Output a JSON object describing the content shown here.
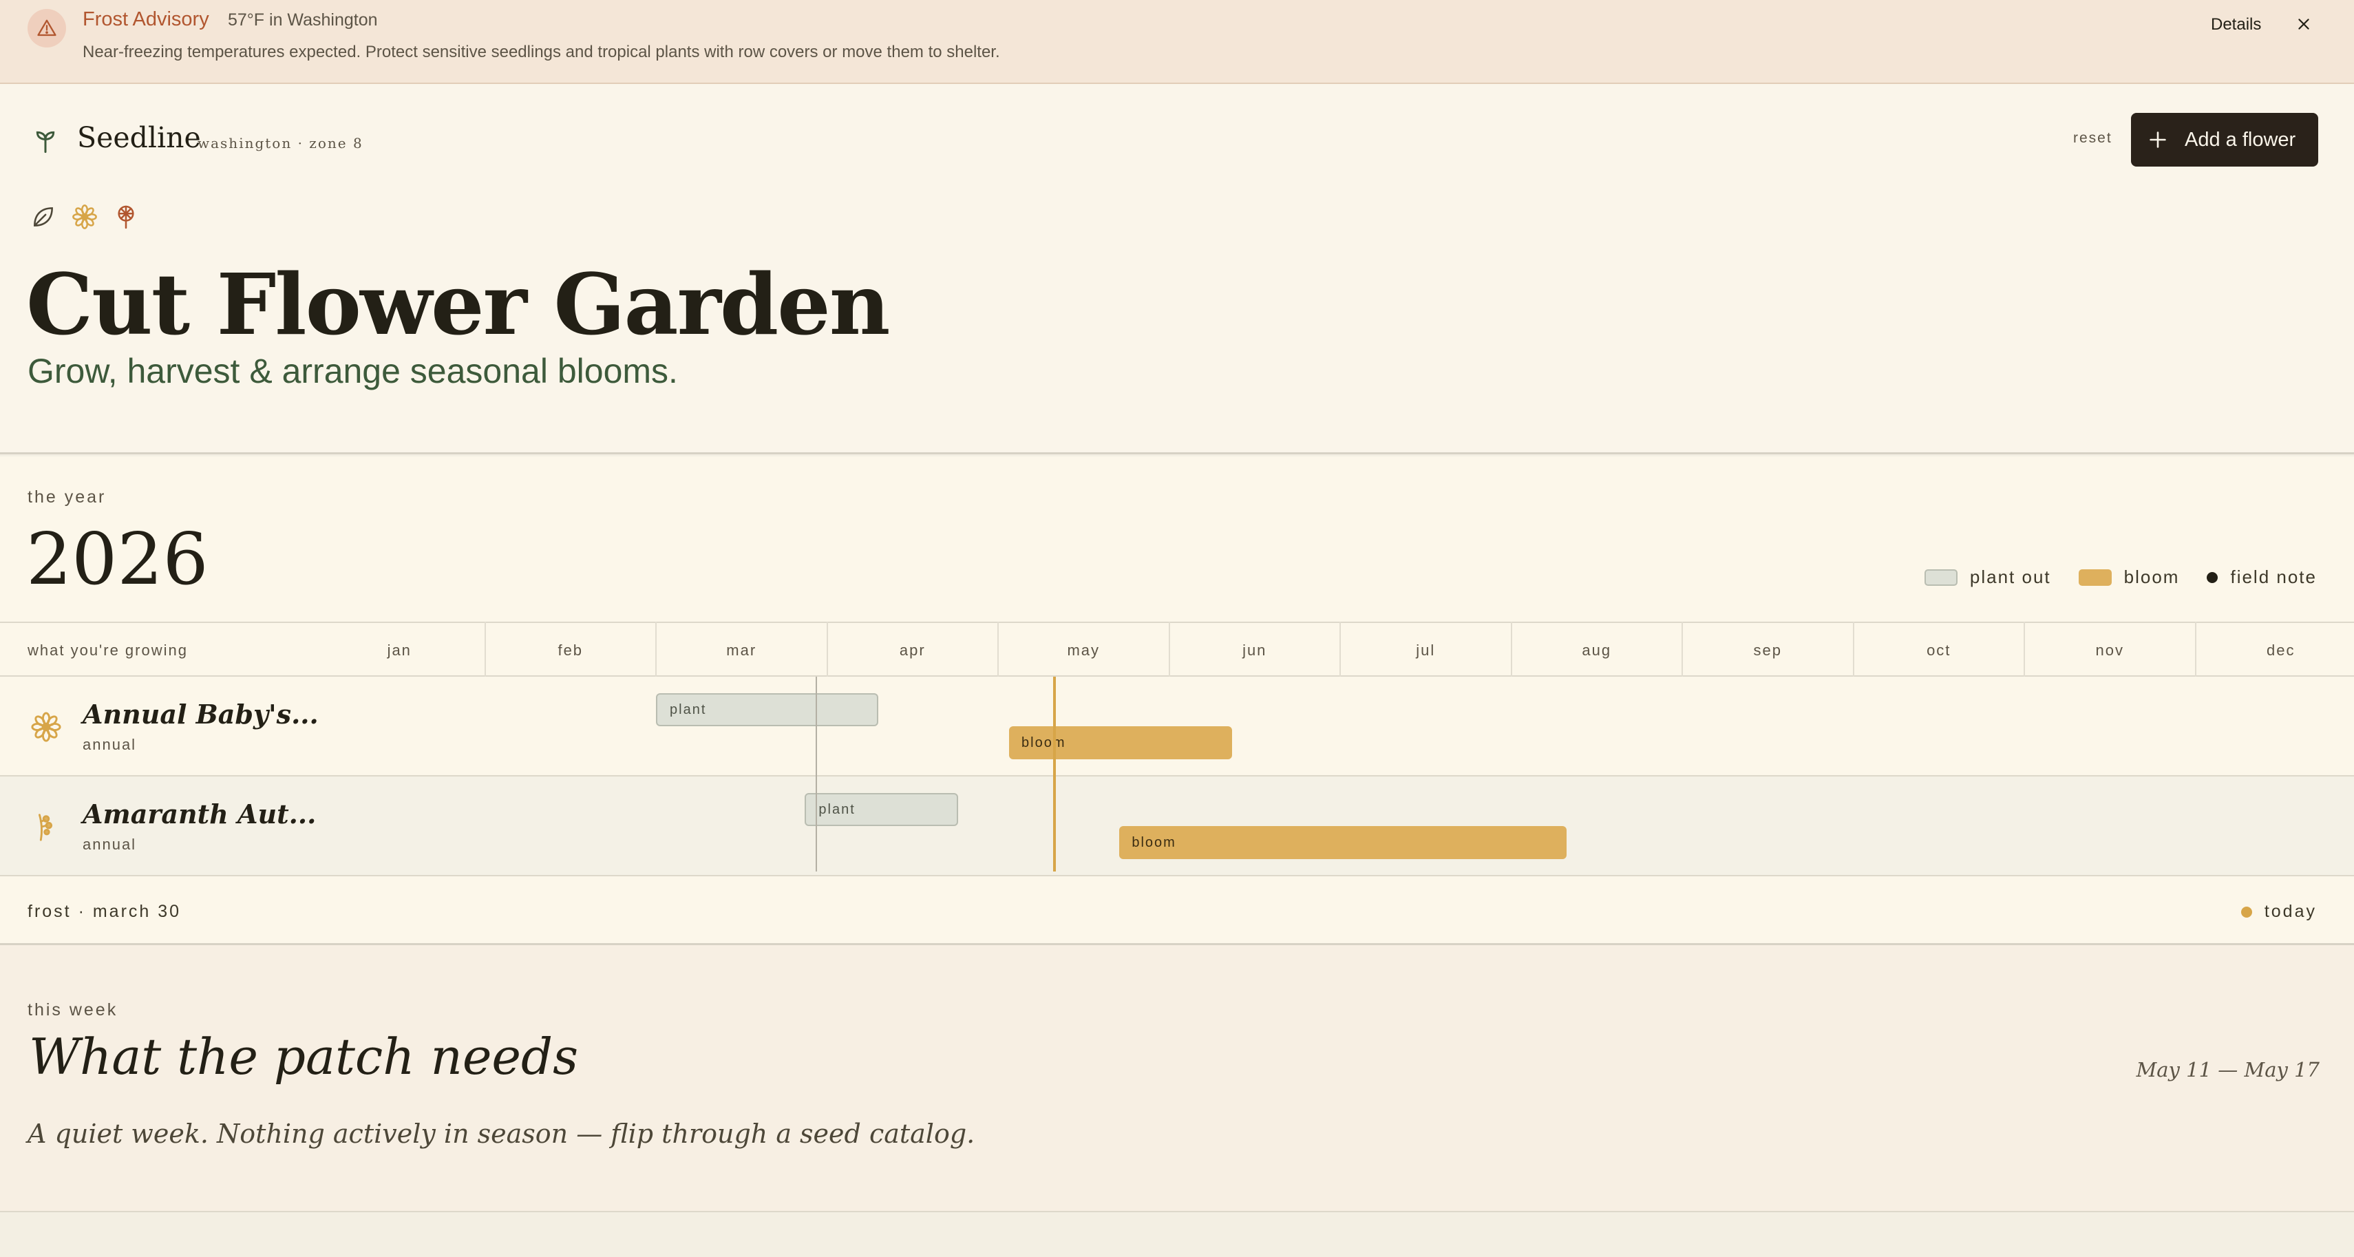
{
  "banner": {
    "title": "Frost Advisory",
    "temp": "57°F in Washington",
    "message": "Near-freezing temperatures expected. Protect sensitive seedlings and tropical plants with row covers or move them to shelter.",
    "details_label": "Details",
    "accent_color": "#b1562f"
  },
  "header": {
    "brand": "Seedline",
    "location": "washington · zone 8",
    "reset_label": "reset",
    "add_label": "Add a flower"
  },
  "hero": {
    "icons": [
      "leaf-icon",
      "daisy-icon",
      "dahlia-icon"
    ],
    "title": "Cut Flower Garden",
    "subtitle": "Grow, harvest & arrange seasonal blooms."
  },
  "year": {
    "label": "the year",
    "value": "2026",
    "legend": {
      "plant": "plant out",
      "bloom": "bloom",
      "note": "field note"
    }
  },
  "timeline": {
    "column_label": "what you're growing",
    "months": [
      "jan",
      "feb",
      "mar",
      "apr",
      "may",
      "jun",
      "jul",
      "aug",
      "sep",
      "oct",
      "nov",
      "dec"
    ],
    "rows": [
      {
        "name": "Annual Baby's...",
        "type": "annual",
        "icon": "daisy-icon",
        "plant": {
          "label": "plant",
          "start": "2026-03-01",
          "end": "2026-04-10"
        },
        "bloom": {
          "label": "bloom",
          "start": "2026-05-03",
          "end": "2026-06-12"
        }
      },
      {
        "name": "Amaranth Aut...",
        "type": "annual",
        "icon": "amaranth-icon",
        "plant": {
          "label": "plant",
          "start": "2026-03-28",
          "end": "2026-04-24"
        },
        "bloom": {
          "label": "bloom",
          "start": "2026-05-23",
          "end": "2026-08-11"
        }
      }
    ],
    "frost_date": "2026-03-30",
    "today_date": "2026-05-11",
    "frost_label": "frost · march 30",
    "today_label": "today",
    "plant_color": "#dde0d6",
    "bloom_color": "#deb05d",
    "today_color": "#d7a548"
  },
  "week": {
    "label": "this week",
    "title": "What the patch needs",
    "range": "May 11 — May 17",
    "message": "A quiet week. Nothing actively in season — flip through a seed catalog."
  }
}
